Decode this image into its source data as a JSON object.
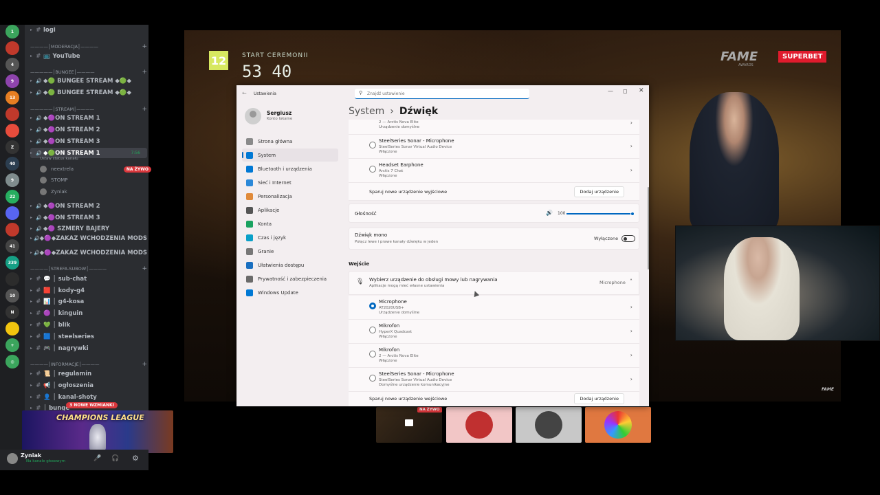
{
  "discord": {
    "servers": [
      {
        "color": "#3ba55d",
        "badge": "1"
      },
      {
        "color": "#c0392b",
        "badge": ""
      },
      {
        "color": "#555",
        "badge": "4"
      },
      {
        "color": "#8e44ad",
        "badge": "9"
      },
      {
        "color": "#e67e22",
        "badge": "13"
      },
      {
        "color": "#c0392b",
        "badge": ""
      },
      {
        "color": "#e74c3c",
        "badge": ""
      },
      {
        "color": "#333",
        "badge": "Z"
      },
      {
        "color": "#2c3e50",
        "badge": "40"
      },
      {
        "color": "#7f8c8d",
        "badge": "9"
      },
      {
        "color": "#27ae60",
        "badge": "22"
      },
      {
        "color": "#5865f2",
        "badge": ""
      },
      {
        "color": "#c0392b",
        "badge": ""
      },
      {
        "color": "#444",
        "badge": "41"
      },
      {
        "color": "#16a085",
        "badge": "339"
      },
      {
        "color": "#2c2c2c",
        "badge": ""
      },
      {
        "color": "#555",
        "badge": "10"
      },
      {
        "color": "#333",
        "badge": "N"
      },
      {
        "color": "#f1c40f",
        "badge": ""
      },
      {
        "color": "#3ba55d",
        "badge": "+"
      },
      {
        "color": "#3ba55d",
        "badge": "◎"
      }
    ],
    "channels": [
      {
        "type": "text",
        "name": "logi"
      },
      {
        "type": "cat",
        "name": "————│MODERACJA│————"
      },
      {
        "type": "text",
        "name": "📺 YouTube"
      },
      {
        "type": "cat",
        "name": "—————│BUNGEE│————"
      },
      {
        "type": "voice",
        "name": "◆🟢 BUNGEE STREAM ◆🟢◆"
      },
      {
        "type": "voice",
        "name": "◆🟢 BUNGEE STREAM ◆🟢◆"
      },
      {
        "type": "cat",
        "name": "—————│STREAM│————"
      },
      {
        "type": "voice",
        "name": "◆🟣ON STREAM 1"
      },
      {
        "type": "voice",
        "name": "◆🟣ON STREAM 2"
      },
      {
        "type": "voice",
        "name": "◆🟣ON STREAM 3"
      },
      {
        "type": "voice",
        "name": "◆🟢ON STREAM 1",
        "active": true,
        "time": "7:56"
      },
      {
        "type": "status",
        "name": "Ustaw status kanału"
      },
      {
        "type": "user",
        "name": "neextrela",
        "live": "NA ŻYWO"
      },
      {
        "type": "user",
        "name": "STOMP"
      },
      {
        "type": "user",
        "name": "Zyniak"
      },
      {
        "type": "voice",
        "name": "◆🟣ON STREAM 2"
      },
      {
        "type": "voice",
        "name": "◆🟣ON STREAM 3"
      },
      {
        "type": "voice",
        "name": "◆🟣 SZMERY BAJERY"
      },
      {
        "type": "voice",
        "name": "◆🟣◆ZAKAZ WCHODZENIA MODS"
      },
      {
        "type": "voice",
        "name": "◆🟣◆ZAKAZ WCHODZENIA MODS"
      },
      {
        "type": "cat",
        "name": "————│STREFA-SUBOW│————"
      },
      {
        "type": "text",
        "name": "💬 │ sub-chat"
      },
      {
        "type": "text",
        "name": "🟥 │ kody-g4"
      },
      {
        "type": "text",
        "name": "📊 │ g4-kosa"
      },
      {
        "type": "text",
        "name": "🟣 │ kinguin"
      },
      {
        "type": "text",
        "name": "💚 │ blik"
      },
      {
        "type": "text",
        "name": "🟦 │ steelseries"
      },
      {
        "type": "text",
        "name": "🎮 │ nagrywki"
      },
      {
        "type": "cat",
        "name": "————│INFORMACJE│————"
      },
      {
        "type": "text",
        "name": "📜 │ regulamin"
      },
      {
        "type": "text",
        "name": "📢 │ ogłoszenia"
      },
      {
        "type": "text",
        "name": "👤 │ kanal-shoty"
      },
      {
        "type": "text",
        "name": "│ bunge"
      }
    ],
    "mentions_badge": "3 NOWE WZMIANKI",
    "banner_text": "CHAMPIONS LEAGUE",
    "user": {
      "name": "Zyniak",
      "status": "Na kanale głosowym"
    }
  },
  "stream": {
    "timer_badge": "12",
    "timer_label": "START CEREMONII",
    "timer_value": "53 40",
    "logo_fame": "FAME",
    "logo_fame_sub": "AWARDS",
    "logo_superbet": "SUPERBET",
    "watermark": "FAME",
    "tile_live": "NA ŻYWO"
  },
  "settings": {
    "window_title": "Ustawienia",
    "search_placeholder": "Znajdź ustawienie",
    "user_name": "Sergiusz",
    "user_type": "Konto lokalne",
    "breadcrumb_parent": "System",
    "breadcrumb_sep": "›",
    "breadcrumb_current": "Dźwięk",
    "nav": [
      {
        "label": "Strona główna",
        "color": "#8a8a8a"
      },
      {
        "label": "System",
        "color": "#0078d4",
        "selected": true
      },
      {
        "label": "Bluetooth i urządzenia",
        "color": "#0078d4"
      },
      {
        "label": "Sieć i Internet",
        "color": "#2b88d8"
      },
      {
        "label": "Personalizacja",
        "color": "#e08a3a"
      },
      {
        "label": "Aplikacje",
        "color": "#555"
      },
      {
        "label": "Konta",
        "color": "#1aa260"
      },
      {
        "label": "Czas i język",
        "color": "#0aa0c8"
      },
      {
        "label": "Granie",
        "color": "#777"
      },
      {
        "label": "Ułatwienia dostępu",
        "color": "#1a6fc0"
      },
      {
        "label": "Prywatność i zabezpieczenia",
        "color": "#6a6a6a"
      },
      {
        "label": "Windows Update",
        "color": "#0078d4"
      }
    ],
    "output_devices": [
      {
        "name": "",
        "sub": "2 — Arctis Nova Elite",
        "status": "Urządzenie domyślne",
        "partial": true
      },
      {
        "name": "SteelSeries Sonar - Microphone",
        "sub": "SteelSeries Sonar Virtual Audio Device",
        "status": "Włączone"
      },
      {
        "name": "Headset Earphone",
        "sub": "Arctis 7 Chat",
        "status": "Włączone"
      }
    ],
    "pair_output_label": "Sparuj nowe urządzenie wyjściowe",
    "add_device_label": "Dodaj urządzenie",
    "volume_label": "Głośność",
    "volume_value": "100",
    "volume_level": 1.0,
    "mono_title": "Dźwięk mono",
    "mono_desc": "Połącz lewe i prawe kanały dźwięku w jeden",
    "mono_state": "Wyłączone",
    "input_heading": "Wejście",
    "input_select_title": "Wybierz urządzenie do obsługi mowy lub nagrywania",
    "input_select_desc": "Aplikacje mogą mieć własne ustawienia",
    "input_selected": "Microphone",
    "input_devices": [
      {
        "name": "Microphone",
        "sub": "AT2020USB+",
        "status": "Urządzenie domyślne",
        "selected": true
      },
      {
        "name": "Mikrofon",
        "sub": "HyperX Quadcast",
        "status": "Włączone"
      },
      {
        "name": "Mikrofon",
        "sub": "2 — Arctis Nova Elite",
        "status": "Włączone"
      },
      {
        "name": "SteelSeries Sonar - Microphone",
        "sub": "SteelSeries Sonar Virtual Audio Device",
        "status": "Domyślne urządzenie komunikacyjne"
      }
    ],
    "pair_input_label": "Sparuj nowe urządzenie wejściowe",
    "add_input_label": "Dodaj urządzenie"
  }
}
